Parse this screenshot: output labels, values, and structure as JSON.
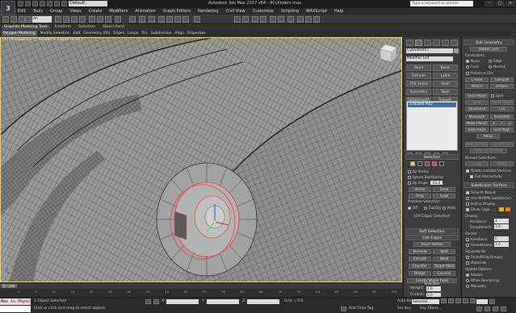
{
  "app": {
    "logo": "3",
    "title": "Autodesk 3ds Max 2017 x64 - 4Cylinders.max"
  },
  "workspace": {
    "value": "Default"
  },
  "search": {
    "placeholder": "Type a keyword or phrase"
  },
  "window_buttons": [
    "–",
    "□",
    "×"
  ],
  "menu": [
    "Edit",
    "Tools",
    "Group",
    "Views",
    "Create",
    "Modifiers",
    "Animation",
    "Graph Editors",
    "Rendering",
    "Civil View",
    "Customize",
    "Scripting",
    "MAXScript",
    "Help"
  ],
  "toolbar": {
    "selection_filter": "All"
  },
  "ribbon": {
    "tabs": [
      "Graphite Modeling Tools",
      "Freeform",
      "Selection",
      "Object Paint"
    ],
    "subtabs": [
      "Polygon Modeling",
      "Modify Selection",
      "Edit",
      "Geometry (All)",
      "Edges",
      "Loops",
      "Tris",
      "Subdivision",
      "Align",
      "Properties"
    ]
  },
  "viewport": {
    "label": "[+] [Perspective ] [ Shaded + Edged Faces ]"
  },
  "modify_panel": {
    "object_name": "Cylinder007",
    "modifier_list": "Modifier List",
    "buttons": [
      "Bend",
      "Bevel",
      "Extrude",
      "Lathe",
      "FFD 3x3x3",
      "Shell",
      "Symmetry",
      "Taper",
      "TurboSmooth",
      "Smooth"
    ],
    "stack_item": "Editable Poly",
    "selection": {
      "header": "Selection",
      "by_vertex": "By Vertex",
      "ignore_backfacing": "Ignore Backfacing",
      "by_angle": "By Angle:",
      "angle": "45.0",
      "shrink": "Shrink",
      "grow": "Grow",
      "ring": "Ring",
      "loop": "Loop",
      "preview_selection": "Preview Selection",
      "off": "Off",
      "subobj": "SubObj",
      "multi": "Multi",
      "status": "100 Edges Selected"
    },
    "soft_selection": "Soft Selection",
    "edit_edges": {
      "header": "Edit Edges",
      "insert_vertex": "Insert Vertex",
      "remove": "Remove",
      "split": "Split",
      "extrude": "Extrude",
      "weld": "Weld",
      "chamfer": "Chamfer",
      "target_weld": "Target Weld",
      "bridge": "Bridge",
      "connect": "Connect",
      "create_shape": "Create Shape From Selection",
      "weight_label": "Weight:",
      "weight": "1.0",
      "crease_label": "Crease:",
      "crease": "0.0"
    }
  },
  "edit_geometry": {
    "header": "Edit Geometry",
    "repeat_last": "Repeat Last",
    "constraints": "Constraints",
    "none": "None",
    "edge": "Edge",
    "face": "Face",
    "normal": "Normal",
    "preserve_uvs": "Preserve UVs",
    "create": "Create",
    "collapse": "Collapse",
    "attach": "Attach",
    "detach": "Detach",
    "slice_plane": "Slice Plane",
    "split": "Split",
    "slice": "Slice",
    "reset_plane": "Reset Plane",
    "quickslice": "QuickSlice",
    "cut": "Cut",
    "msmooth": "MSmooth",
    "tessellate": "Tessellate",
    "make_planar": "Make Planar",
    "x": "X",
    "y": "Y",
    "z": "Z",
    "view_align": "View Align",
    "grid_align": "Grid Align",
    "relax": "Relax",
    "hide_selected": "Hide Selected",
    "unhide_all": "Unhide All",
    "hide_unselected": "Hide Unselected",
    "named_selections": "Named Selections:",
    "copy": "Copy",
    "paste": "Paste",
    "delete_isolated": "Delete Isolated Vertices",
    "full_interactivity": "Full Interactivity"
  },
  "subdivision_surface": {
    "header": "Subdivision Surface",
    "smooth_result": "Smooth Result",
    "use_nurms": "Use NURMS Subdivision",
    "isoline": "Isoline Display",
    "show_cage": "Show Cage......",
    "display": "Display",
    "iterations_label": "Iterations:",
    "iterations": "1",
    "smoothness_label": "Smoothness:",
    "smoothness": "1.0",
    "render": "Render",
    "r_iterations": "0",
    "r_smoothness": "1.0",
    "separate_by": "Separate By",
    "smoothing_groups": "Smoothing Groups",
    "materials": "Materials",
    "update_options": "Update Options",
    "always": "Always",
    "when_rendering": "When Rendering",
    "manually": "Manually"
  },
  "timeline": {
    "frame": "0 / 100",
    "ticks": [
      "0",
      "5",
      "10",
      "15",
      "20",
      "25",
      "30",
      "35",
      "40",
      "45",
      "50",
      "55",
      "60",
      "65",
      "70",
      "75",
      "80",
      "85",
      "90",
      "95",
      "100"
    ]
  },
  "status": {
    "maxscript": "Max to Physc",
    "selected": "1 Object Selected",
    "prompt": "Click or click-and-drag to select objects",
    "x_label": "X:",
    "x": "",
    "y_label": "Y:",
    "y": "",
    "z_label": "Z:",
    "z": "",
    "grid": "Grid = 0.0",
    "add_time_tag": "Add Time Tag",
    "auto_key": "Auto Key",
    "selected_dd": "Selected",
    "set_key": "Set Key",
    "key_filters": "Key Filters..."
  },
  "colors": {
    "viewport_bg": "#8c8c8c",
    "selection_edge": "#e05050",
    "accent": "#3a6ea5",
    "active_border": "#ffd24a"
  }
}
